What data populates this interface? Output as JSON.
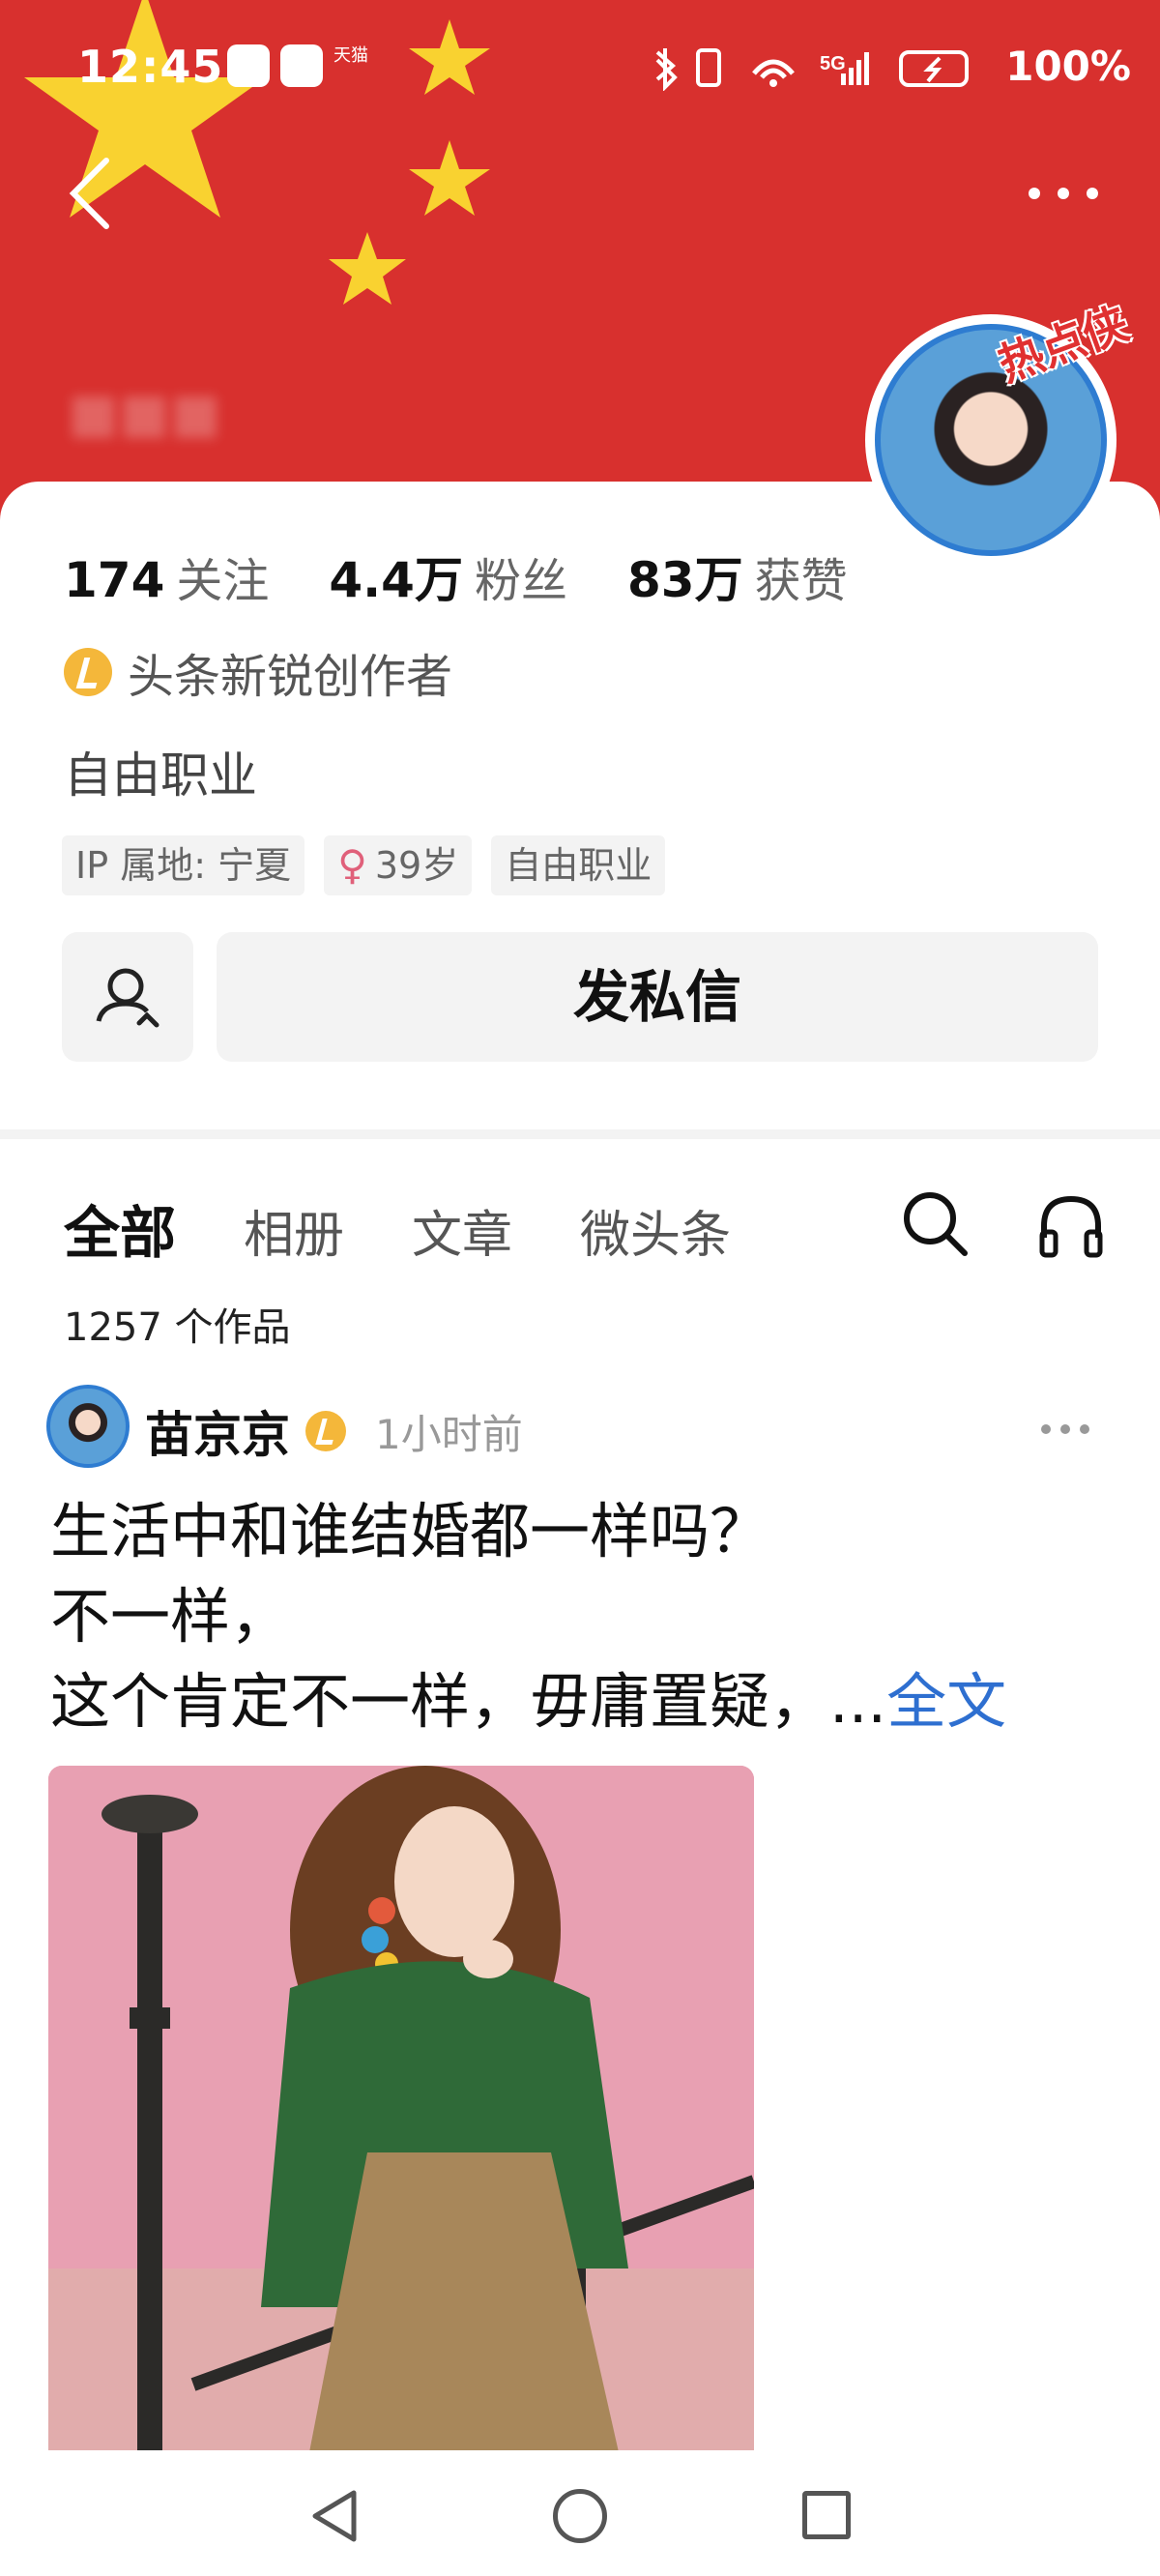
{
  "status_bar": {
    "time": "12:45",
    "app_label": "天猫",
    "battery": "100%"
  },
  "profile": {
    "avatar_tag": "热点侠",
    "following_count": "174",
    "following_label": "关注",
    "fans_count": "4.4万",
    "fans_label": "粉丝",
    "likes_count": "83万",
    "likes_label": "获赞",
    "creator_badge": "头条新锐创作者",
    "bio": "自由职业",
    "tags": {
      "ip": "IP 属地: 宁夏",
      "gender_symbol": "♀",
      "age": "39岁",
      "occupation": "自由职业"
    },
    "message_button": "发私信"
  },
  "tabs": {
    "all": "全部",
    "album": "相册",
    "articles": "文章",
    "micro": "微头条"
  },
  "works_count": "1257 个作品",
  "post": {
    "author": "苗京京",
    "time": "1小时前",
    "line1": "生活中和谁结婚都一样吗？",
    "line2": "不一样，",
    "line3": "这个肯定不一样，毋庸置疑，...",
    "full_text_link": "全文"
  },
  "colors": {
    "banner_red": "#d8302e",
    "star_yellow": "#f9d230",
    "link_blue": "#2e6fd0",
    "badge_gold": "#f4b73a"
  },
  "icons": [
    "back-icon",
    "more-icon",
    "follow-icon",
    "search-icon",
    "headphones-icon",
    "nav-back-icon",
    "nav-home-icon",
    "nav-recent-icon"
  ]
}
